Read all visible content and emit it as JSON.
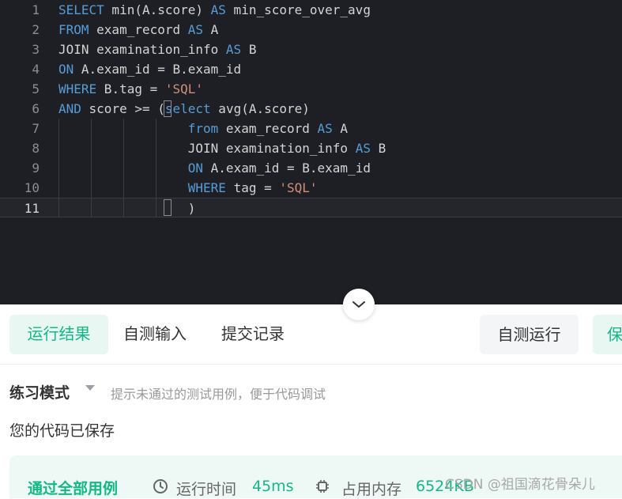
{
  "editor": {
    "current_line": 11,
    "lines": [
      {
        "n": "1",
        "tokens": [
          [
            "kw",
            "SELECT"
          ],
          [
            "t",
            " min(A.score) "
          ],
          [
            "kw",
            "AS"
          ],
          [
            "t",
            " min_score_over_avg"
          ]
        ]
      },
      {
        "n": "2",
        "tokens": [
          [
            "kw",
            "FROM"
          ],
          [
            "t",
            " exam_record "
          ],
          [
            "kw",
            "AS"
          ],
          [
            "t",
            " A"
          ]
        ]
      },
      {
        "n": "3",
        "tokens": [
          [
            "t",
            "JOIN examination_info "
          ],
          [
            "kw",
            "AS"
          ],
          [
            "t",
            " B"
          ]
        ]
      },
      {
        "n": "4",
        "tokens": [
          [
            "kw",
            "ON"
          ],
          [
            "t",
            " A.exam_id = B.exam_id"
          ]
        ]
      },
      {
        "n": "5",
        "tokens": [
          [
            "kw",
            "WHERE"
          ],
          [
            "t",
            " B.tag = "
          ],
          [
            "str",
            "'SQL'"
          ]
        ]
      },
      {
        "n": "6",
        "tokens": [
          [
            "kw",
            "AND"
          ],
          [
            "t",
            " score >= ("
          ],
          [
            "kw",
            "select"
          ],
          [
            "t",
            " avg(A.score)"
          ]
        ]
      },
      {
        "n": "7",
        "tokens": [
          [
            "t",
            "                 "
          ],
          [
            "kw",
            "from"
          ],
          [
            "t",
            " exam_record "
          ],
          [
            "kw",
            "AS"
          ],
          [
            "t",
            " A"
          ]
        ]
      },
      {
        "n": "8",
        "tokens": [
          [
            "t",
            "                 JOIN examination_info "
          ],
          [
            "kw",
            "AS"
          ],
          [
            "t",
            " B"
          ]
        ]
      },
      {
        "n": "9",
        "tokens": [
          [
            "t",
            "                 "
          ],
          [
            "kw",
            "ON"
          ],
          [
            "t",
            " A.exam_id = B.exam_id"
          ]
        ]
      },
      {
        "n": "10",
        "tokens": [
          [
            "t",
            "                 "
          ],
          [
            "kw",
            "WHERE"
          ],
          [
            "t",
            " tag = "
          ],
          [
            "str",
            "'SQL'"
          ]
        ]
      },
      {
        "n": "11",
        "tokens": [
          [
            "t",
            "                 )"
          ]
        ]
      }
    ]
  },
  "tabs": {
    "run_result": "运行结果",
    "self_input": "自测输入",
    "submit_records": "提交记录"
  },
  "actions": {
    "self_run": "自测运行",
    "save": "保"
  },
  "panel": {
    "mode": "练习模式",
    "hint": "提示未通过的测试用例，便于代码调试",
    "saved_msg": "您的代码已保存"
  },
  "result": {
    "status": "通过全部用例",
    "runtime_label": "运行时间",
    "runtime_value": "45ms",
    "memory_label": "占用内存",
    "memory_value": "6524KB"
  },
  "watermark": "CSDN @祖国滴花骨朵儿",
  "colors": {
    "editor_bg": "#1e1f24",
    "keyword": "#569cd6",
    "string": "#ce9178",
    "accent_green": "#13b884"
  },
  "icons": {
    "collapse": "chevron-down-icon",
    "mode": "caret-down-icon",
    "runtime": "clock-icon",
    "memory": "chip-icon"
  }
}
